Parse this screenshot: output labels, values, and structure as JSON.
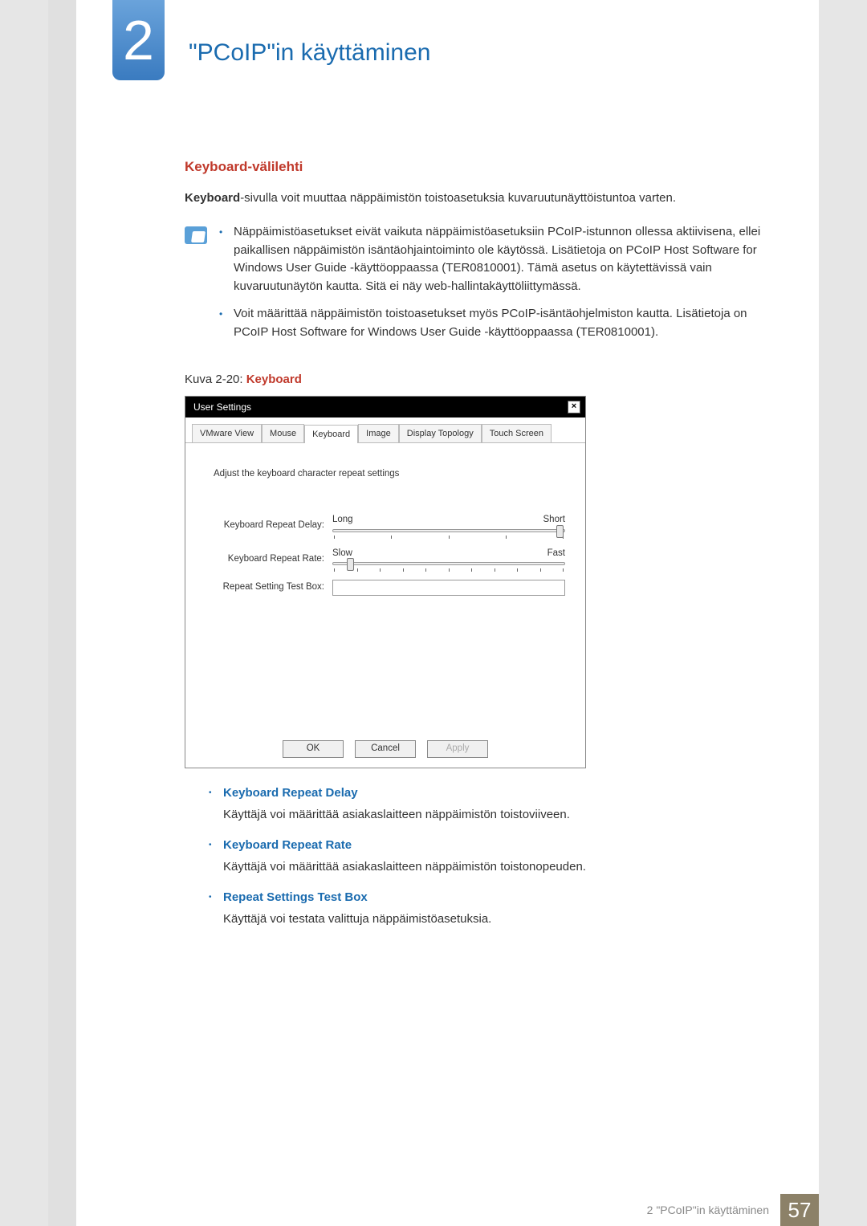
{
  "header": {
    "chapter_number": "2",
    "chapter_title": "\"PCoIP\"in käyttäminen"
  },
  "section": {
    "title": "Keyboard-välilehti",
    "intro_kw": "Keyboard",
    "intro_rest": "-sivulla voit muuttaa näppäimistön toistoasetuksia kuvaruutunäyttöistuntoa varten.",
    "notes": [
      "Näppäimistöasetukset eivät vaikuta näppäimistöasetuksiin PCoIP-istunnon ollessa aktiivisena, ellei paikallisen näppäimistön isäntäohjaintoiminto ole käytössä. Lisätietoja on PCoIP Host Software for Windows User Guide -käyttöoppaassa (TER0810001). Tämä asetus on käytettävissä vain kuvaruutunäytön kautta. Sitä ei näy web-hallintakäyttöliittymässä.",
      "Voit määrittää näppäimistön toistoasetukset myös PCoIP-isäntäohjelmiston kautta. Lisätietoja on PCoIP Host Software for Windows User Guide -käyttöoppaassa (TER0810001)."
    ],
    "figure_caption_prefix": "Kuva 2-20: ",
    "figure_caption_kw": "Keyboard"
  },
  "dialog": {
    "title": "User Settings",
    "tabs": [
      "VMware View",
      "Mouse",
      "Keyboard",
      "Image",
      "Display Topology",
      "Touch Screen"
    ],
    "active_tab_index": 2,
    "instruction": "Adjust the keyboard character repeat settings",
    "delay_label": "Keyboard Repeat Delay:",
    "delay_left": "Long",
    "delay_right": "Short",
    "rate_label": "Keyboard Repeat Rate:",
    "rate_left": "Slow",
    "rate_right": "Fast",
    "testbox_label": "Repeat Setting Test Box:",
    "ok": "OK",
    "cancel": "Cancel",
    "apply": "Apply"
  },
  "descriptions": [
    {
      "kw": "Keyboard Repeat Delay",
      "text": "Käyttäjä voi määrittää asiakaslaitteen näppäimistön toistoviiveen."
    },
    {
      "kw": "Keyboard Repeat Rate",
      "text": "Käyttäjä voi määrittää asiakaslaitteen näppäimistön toistonopeuden."
    },
    {
      "kw": "Repeat Settings Test Box",
      "text": "Käyttäjä voi testata valittuja näppäimistöasetuksia."
    }
  ],
  "footer": {
    "text": "2 \"PCoIP\"in käyttäminen",
    "page": "57"
  }
}
